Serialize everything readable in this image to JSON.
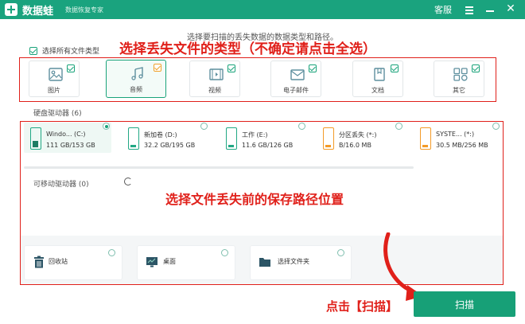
{
  "titlebar": {
    "app_name": "数据蛙",
    "subtitle": "数据恢复专家",
    "help": "客服",
    "bg_color": "#1aa37e"
  },
  "instruction": "选择要扫描的丢失数据的数据类型和路径。",
  "select_all": {
    "label": "选择所有文件类型",
    "checked": true
  },
  "annotations": {
    "types": "选择丢失文件的类型（不确定请点击全选）",
    "path": "选择文件丢失前的保存路径位置",
    "scan": "点击【扫描】",
    "color": "#e0201a"
  },
  "file_types": [
    {
      "label": "图片",
      "icon": "image-icon",
      "checked": true,
      "selected": false
    },
    {
      "label": "音频",
      "icon": "music-icon",
      "checked": true,
      "selected": true
    },
    {
      "label": "视频",
      "icon": "video-icon",
      "checked": true,
      "selected": false
    },
    {
      "label": "电子邮件",
      "icon": "email-icon",
      "checked": true,
      "selected": false
    },
    {
      "label": "文档",
      "icon": "document-icon",
      "checked": true,
      "selected": false
    },
    {
      "label": "其它",
      "icon": "other-icon",
      "checked": true,
      "selected": false
    }
  ],
  "hard_drives": {
    "title": "硬盘驱动器",
    "count": "(6)",
    "items": [
      {
        "name": "Windo... (C:)",
        "size": "111 GB/153 GB",
        "selected": true
      },
      {
        "name": "新加卷 (D:)",
        "size": "32.2 GB/195 GB",
        "selected": false
      },
      {
        "name": "工作 (E:)",
        "size": "11.6 GB/126 GB",
        "selected": false
      },
      {
        "name": "分区丢失 (*:)",
        "size": "B/16.0 MB",
        "selected": false
      },
      {
        "name": "SYSTE... (*:)",
        "size": "30.5 MB/256 MB",
        "selected": false
      }
    ]
  },
  "removable": {
    "title": "可移动驱动器",
    "count": "(0)"
  },
  "locations": [
    {
      "label": "回收站",
      "icon": "trash-icon"
    },
    {
      "label": "桌面",
      "icon": "desktop-icon"
    },
    {
      "label": "选择文件夹",
      "icon": "folder-icon"
    }
  ],
  "scan_button": {
    "label": "扫描",
    "color": "#17a077"
  }
}
